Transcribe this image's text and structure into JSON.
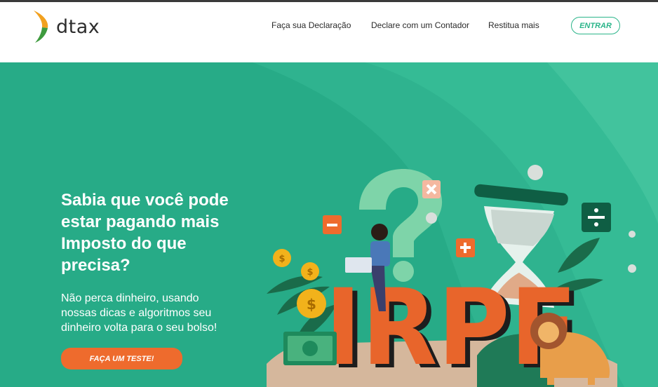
{
  "header": {
    "brand": "dtax",
    "nav": [
      "Faça sua Declaração",
      "Declare com um Contador",
      "Restitua mais"
    ],
    "login_label": "ENTRAR"
  },
  "hero": {
    "headline": "Sabia que você pode estar pagando mais Imposto do que precisa?",
    "subtext": "Não perca dinheiro,  usando nossas dicas e  algoritmos seu dinheiro volta para o seu bolso!",
    "cta_label": "FAÇA UM TESTE!"
  },
  "illustration": {
    "big_text": "IRPF",
    "coin_symbol": "$",
    "icons": [
      "minus-icon",
      "close-icon",
      "plus-icon",
      "divide-icon"
    ]
  },
  "colors": {
    "accent": "#2bb58a",
    "hero_background": "#27ab87",
    "cta": "#ee6b2d",
    "irpf_orange": "#e8652b"
  }
}
